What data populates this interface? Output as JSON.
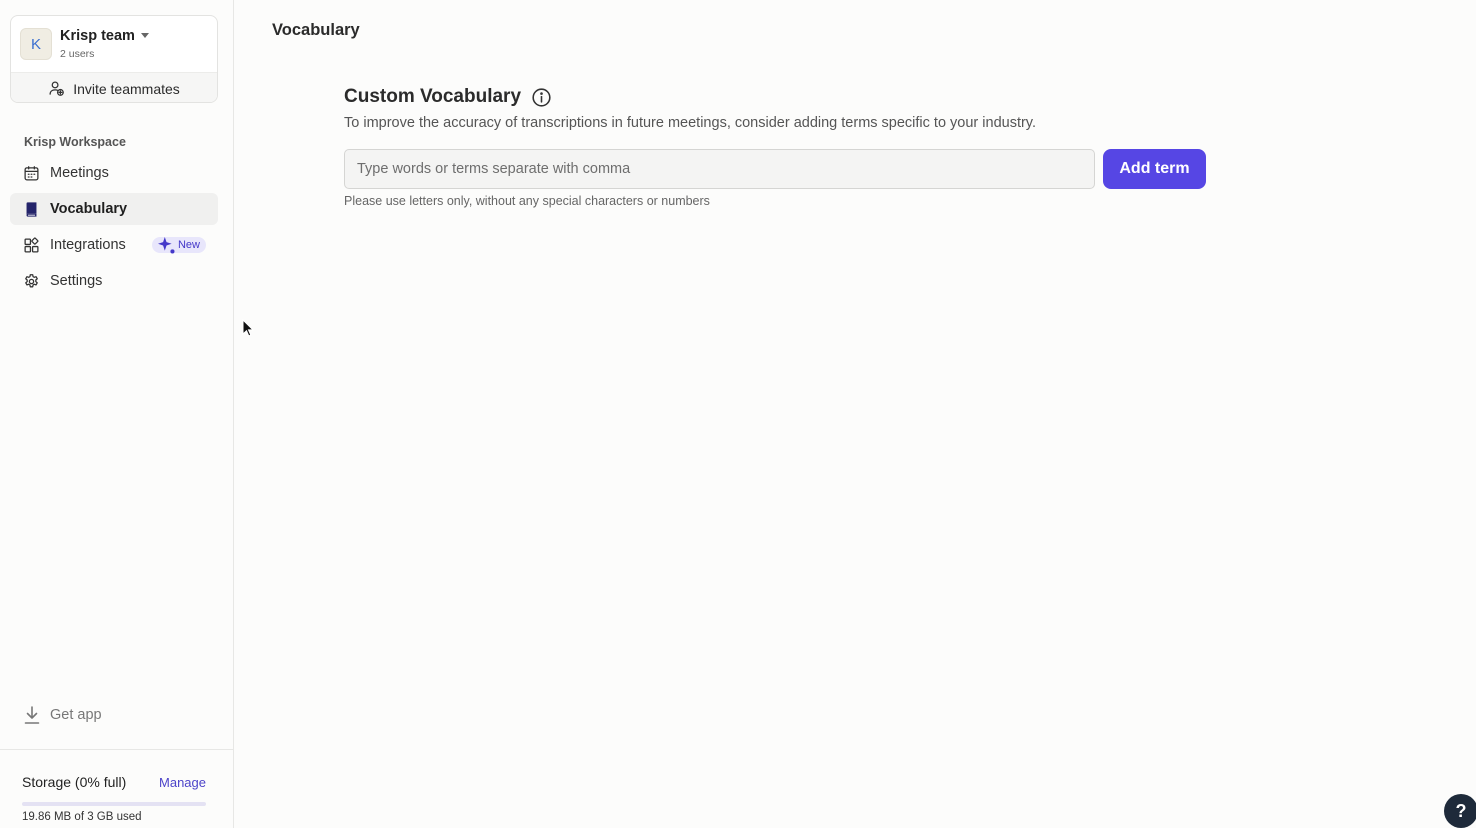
{
  "team": {
    "avatar_letter": "K",
    "name": "Krisp team",
    "users": "2 users",
    "invite_label": "Invite teammates"
  },
  "sidebar": {
    "workspace_label": "Krisp Workspace",
    "items": [
      {
        "label": "Meetings",
        "icon": "calendar-icon",
        "active": false
      },
      {
        "label": "Vocabulary",
        "icon": "book-icon",
        "active": true
      },
      {
        "label": "Integrations",
        "icon": "puzzle-icon",
        "active": false,
        "badge": "New"
      },
      {
        "label": "Settings",
        "icon": "gear-icon",
        "active": false
      }
    ],
    "get_app_label": "Get app"
  },
  "storage": {
    "title": "Storage (0% full)",
    "manage_label": "Manage",
    "used_text": "19.86 MB of 3 GB used",
    "percent_used": 0
  },
  "main": {
    "page_title": "Vocabulary",
    "section_title": "Custom Vocabulary",
    "section_description": "To improve the accuracy of transcriptions in future meetings, consider adding terms specific to your industry.",
    "input_placeholder": "Type words or terms separate with comma",
    "input_value": "",
    "add_button_label": "Add term",
    "hint": "Please use letters only, without any special characters or numbers"
  },
  "help": {
    "label": "?"
  },
  "colors": {
    "accent": "#5646e4",
    "link": "#4d44c9",
    "badge_bg": "#e8e6fb",
    "help_bg": "#1e2a3a"
  }
}
